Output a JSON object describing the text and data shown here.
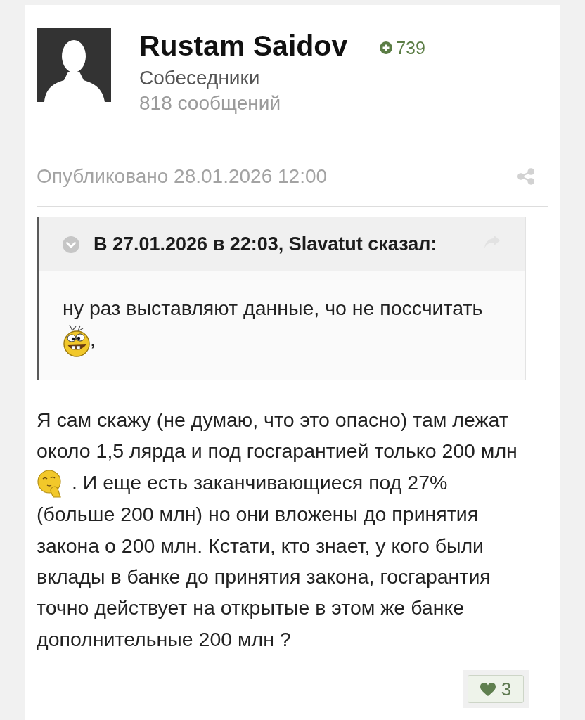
{
  "post": {
    "author": {
      "name": "Rustam Saidov",
      "reputation": "739",
      "group": "Собеседники",
      "posts": "818 сообщений"
    },
    "published": "Опубликовано 28.01.2026 12:00",
    "quote": {
      "header": "В 27.01.2026 в 22:03, Slavatut сказал:",
      "body": [
        {
          "kind": "text",
          "text": "ну раз выставляют данные, чо не поссчитать"
        },
        {
          "kind": "emoji"
        },
        {
          "kind": "text",
          "text": ","
        }
      ]
    },
    "body": [
      {
        "kind": "text",
        "text": "Я сам скажу (не думаю, что это опасно) там лежат около 1,5 лярда и под госгарантией только 200 млн"
      },
      {
        "kind": "emoji"
      },
      {
        "kind": "text",
        "text": ". И еще есть заканчивающиеся под 27% (больше 200 млн) но они вложены до принятия закона о 200 млн. Кстати, кто знает, у кого были вклады в банке до принятия закона, госгарантия точно действует на открытые в этом же банке дополнительные 200 млн ?"
      }
    ],
    "reactions": {
      "count": "3"
    }
  }
}
